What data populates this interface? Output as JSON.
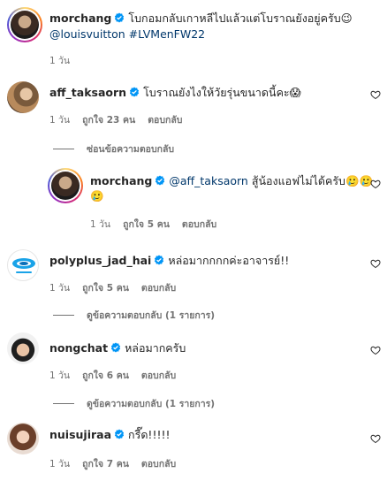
{
  "post": {
    "user": "morchang",
    "text": "โบกอมกลับเกาหลีไปแล้วแต่โบราณยังอยู่ครับ😉",
    "line2": "@louisvuitton #LVMenFW22",
    "time": "1 วัน"
  },
  "comments": [
    {
      "user": "aff_taksaorn",
      "text": "โบราณยังไงให้วัยรุ่นขนาดนี้คะ😱",
      "time": "1 วัน",
      "likes": "ถูกใจ 23 คน",
      "reply": "ตอบกลับ",
      "toggle": "ซ่อนข้อความตอบกลับ",
      "nested": {
        "user": "morchang",
        "mention": "@aff_taksaorn",
        "text": "สู้น้องแอฟไม่ได้ครับ🥲🥲",
        "text2": "🥲",
        "time": "1 วัน",
        "likes": "ถูกใจ 5 คน",
        "reply": "ตอบกลับ"
      }
    },
    {
      "user": "polyplus_jad_hai",
      "text": "หล่อมากกกกค่ะอาจารย์!!",
      "time": "1 วัน",
      "likes": "ถูกใจ 5 คน",
      "reply": "ตอบกลับ",
      "toggle": "ดูข้อความตอบกลับ (1 รายการ)"
    },
    {
      "user": "nongchat",
      "text": "หล่อมากครับ",
      "time": "1 วัน",
      "likes": "ถูกใจ 6 คน",
      "reply": "ตอบกลับ",
      "toggle": "ดูข้อความตอบกลับ (1 รายการ)"
    },
    {
      "user": "nuisujiraa",
      "text": "กรี๊ด!!!!!",
      "time": "1 วัน",
      "likes": "ถูกใจ 7 คน",
      "reply": "ตอบกลับ"
    }
  ],
  "colors": {
    "text": "#262626",
    "muted": "#737373",
    "link": "#00376b",
    "verified": "#0095f6"
  },
  "icons": {
    "verified": "verified-badge-icon",
    "like": "heart-outline-icon"
  }
}
